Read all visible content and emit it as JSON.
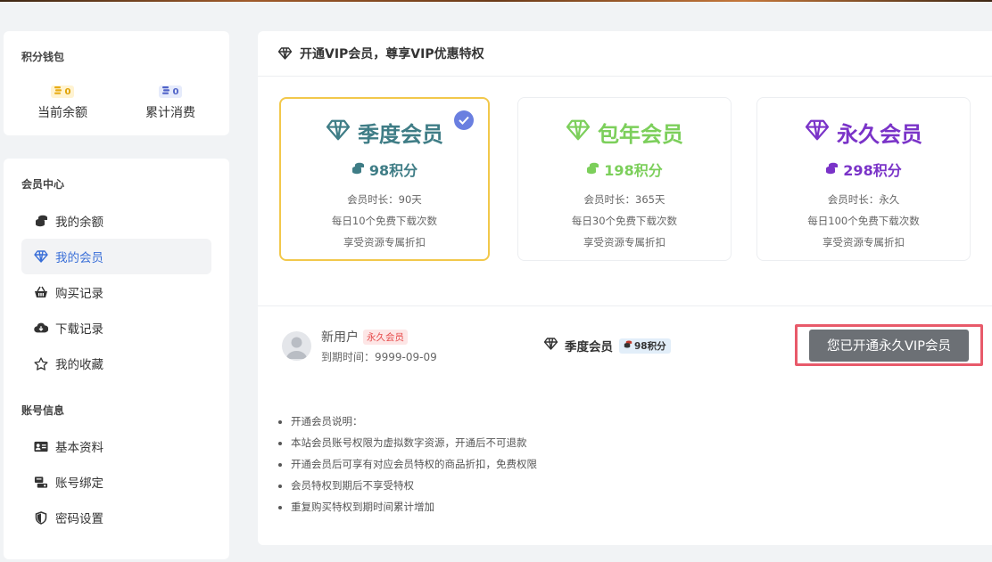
{
  "colors": {
    "quarter": "#3f7d86",
    "year": "#7ccf5b",
    "lifetime": "#7a33c8",
    "selected_border": "#f2c84b",
    "active_menu": "#3a6fd8",
    "highlight_border": "#e85a6a"
  },
  "wallet": {
    "title": "积分钱包",
    "balance": {
      "value": "0",
      "label": "当前余额",
      "icon": "coin-stack-icon"
    },
    "spent": {
      "value": "0",
      "label": "累计消费",
      "icon": "coin-stack-icon"
    }
  },
  "member_center": {
    "title": "会员中心",
    "items": [
      {
        "label": "我的余额",
        "icon": "coins-icon",
        "active": false
      },
      {
        "label": "我的会员",
        "icon": "diamond-icon",
        "active": true
      },
      {
        "label": "购买记录",
        "icon": "basket-icon",
        "active": false
      },
      {
        "label": "下载记录",
        "icon": "cloud-download-icon",
        "active": false
      },
      {
        "label": "我的收藏",
        "icon": "star-icon",
        "active": false
      }
    ]
  },
  "account": {
    "title": "账号信息",
    "items": [
      {
        "label": "基本资料",
        "icon": "id-card-icon"
      },
      {
        "label": "账号绑定",
        "icon": "link-icon"
      },
      {
        "label": "密码设置",
        "icon": "shield-icon"
      }
    ]
  },
  "main": {
    "header": "开通VIP会员，尊享VIP优惠特权",
    "plans": [
      {
        "name": "季度会员",
        "price": "98积分",
        "duration": "会员时长：90天",
        "downloads": "每日10个免费下载次数",
        "perk": "享受资源专属折扣",
        "selected": true
      },
      {
        "name": "包年会员",
        "price": "198积分",
        "duration": "会员时长：365天",
        "downloads": "每日30个免费下载次数",
        "perk": "享受资源专属折扣",
        "selected": false
      },
      {
        "name": "永久会员",
        "price": "298积分",
        "duration": "会员时长：永久",
        "downloads": "每日100个免费下载次数",
        "perk": "享受资源专属折扣",
        "selected": false
      }
    ],
    "user": {
      "name": "新用户",
      "badge": "永久会员",
      "expire": "到期时间：9999-09-09"
    },
    "current_plan": {
      "name": "季度会员",
      "price": "98积分"
    },
    "vip_button": "您已开通永久VIP会员",
    "notes": [
      "开通会员说明：",
      "本站会员账号权限为虚拟数字资源，开通后不可退款",
      "开通会员后可享有对应会员特权的商品折扣，免费权限",
      "会员特权到期后不享受特权",
      "重复购买特权到期时间累计增加"
    ]
  }
}
